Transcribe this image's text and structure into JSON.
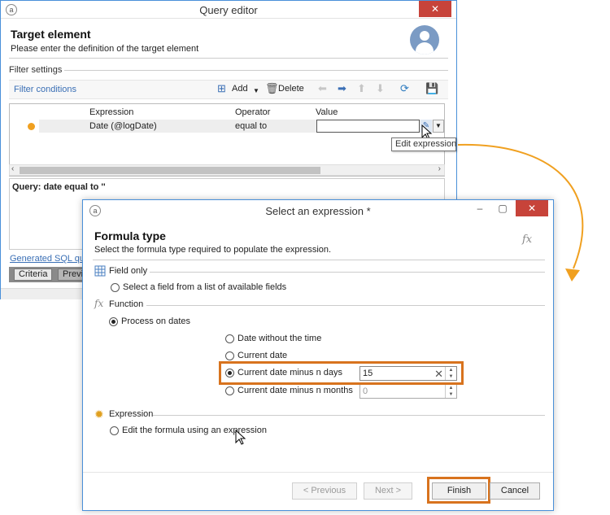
{
  "query_editor": {
    "window_title": "Query editor",
    "close_label": "✕",
    "header_title": "Target element",
    "header_subtitle": "Please enter the definition of the target element",
    "group_label": "Filter settings",
    "toolbar": {
      "filter_conditions": "Filter conditions",
      "add_label": "Add",
      "delete_label": "Delete"
    },
    "grid": {
      "columns": [
        "Expression",
        "Operator",
        "Value"
      ],
      "row": {
        "expression": "Date (@logDate)",
        "operator": "equal to",
        "value": ""
      }
    },
    "tooltip": "Edit expression",
    "query_text": "Query: date equal to ''",
    "sql_link": "Generated SQL que",
    "tabs": [
      "Criteria",
      "Previ"
    ]
  },
  "expression_dialog": {
    "window_title": "Select an expression *",
    "close_label": "✕",
    "header_title": "Formula type",
    "header_subtitle": "Select the formula type required to populate the expression.",
    "fx_label": "fx",
    "sections": {
      "field_only": "Field only",
      "function": "Function",
      "expression": "Expression"
    },
    "options": {
      "select_field": "Select a field from a list of available fields",
      "process_dates": "Process on dates",
      "date_without_time": "Date without the time",
      "current_date": "Current date",
      "current_date_minus_days": "Current date minus n days",
      "current_date_minus_months": "Current date minus n months",
      "edit_formula": "Edit the formula using an expression"
    },
    "days_value": "15",
    "months_value": "0",
    "buttons": {
      "previous": "< Previous",
      "next": "Next >",
      "finish": "Finish",
      "cancel": "Cancel"
    }
  },
  "colors": {
    "accent_orange": "#d8731e",
    "window_border": "#4a90d9",
    "close_red": "#c7433a",
    "link_blue": "#3a6fb5"
  }
}
